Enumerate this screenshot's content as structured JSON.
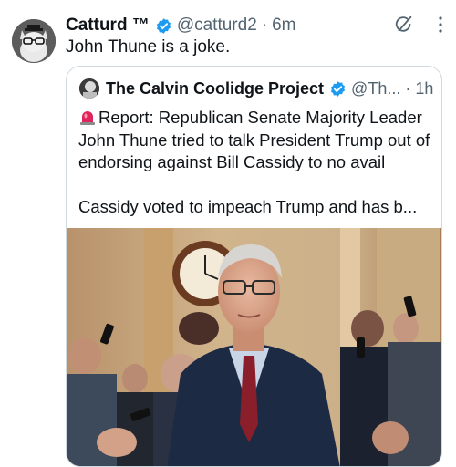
{
  "tweet": {
    "author_name": "Catturd ™",
    "handle": "@catturd2",
    "separator": "·",
    "time": "6m",
    "text": "John Thune is a joke."
  },
  "quote": {
    "author_name": "The Calvin Coolidge Project",
    "handle": "@Th...",
    "separator": "·",
    "time": "1h",
    "line1": "Report: Republican Senate Majority Leader John Thune tried to talk President Trump out of endorsing against Bill Cassidy to no avail",
    "line2": "Cassidy voted to impeach Trump and has b..."
  },
  "icons": {
    "verified": "verified-badge-icon",
    "grok": "grok-icon",
    "more": "more-options-icon",
    "siren": "rotating-light-emoji-icon"
  },
  "colors": {
    "verified_blue": "#1d9bf0",
    "secondary_text": "#536471",
    "border": "#cfd9de"
  }
}
